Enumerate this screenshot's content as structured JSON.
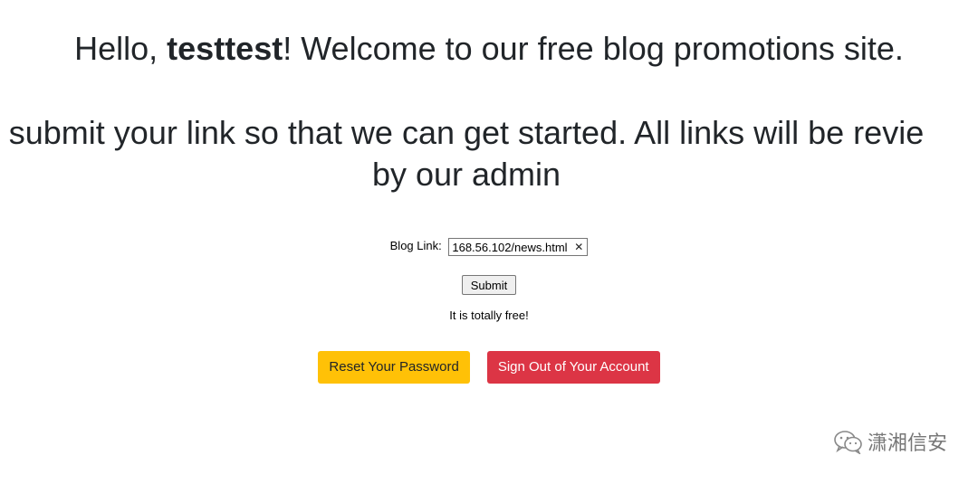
{
  "greeting": {
    "prefix": "Hello, ",
    "username": "testtest",
    "suffix": "! Welcome to our free blog promotions site."
  },
  "instructions": {
    "line1": "submit your link so that we can get started. All links will be revie",
    "line2": "by our admin"
  },
  "form": {
    "label": "Blog Link:",
    "value": "168.56.102/news.html",
    "clear_symbol": "✕",
    "submit_label": "Submit"
  },
  "note": "It is totally free!",
  "actions": {
    "reset_label": "Reset Your Password",
    "signout_label": "Sign Out of Your Account"
  },
  "watermark": {
    "text": "潇湘信安",
    "icon": "wechat-icon"
  },
  "colors": {
    "warning": "#ffc107",
    "danger": "#dc3545"
  }
}
